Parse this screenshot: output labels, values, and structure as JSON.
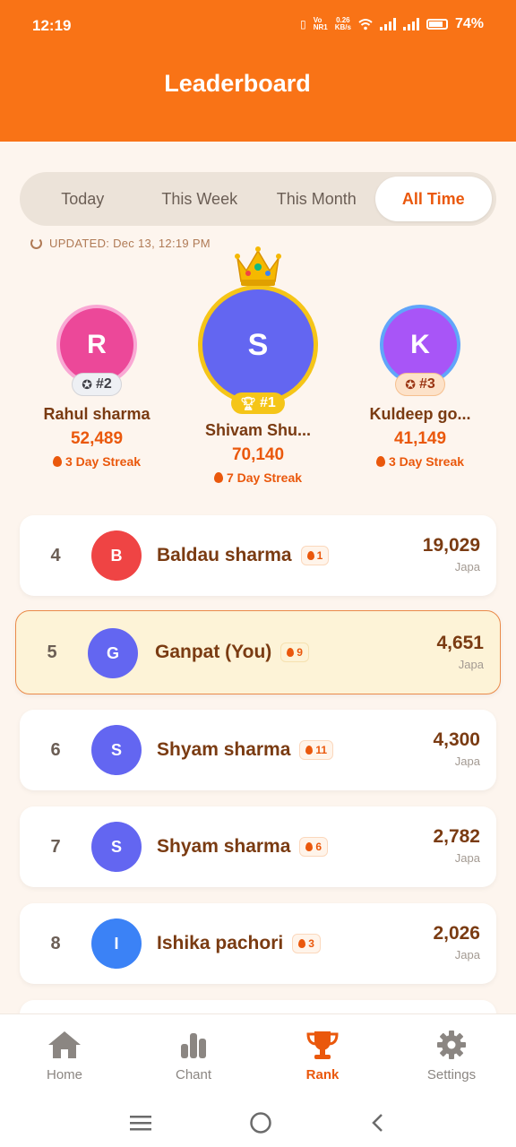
{
  "status": {
    "time": "12:19",
    "net": "Vo\nNR1",
    "speed": "0.26\nKB/s",
    "battery": "74%"
  },
  "header": {
    "title": "Leaderboard"
  },
  "tabs": [
    {
      "label": "Today",
      "active": false
    },
    {
      "label": "This Week",
      "active": false
    },
    {
      "label": "This Month",
      "active": false
    },
    {
      "label": "All Time",
      "active": true
    }
  ],
  "updated": "UPDATED: Dec 13, 12:19 PM",
  "podium": {
    "first": {
      "initial": "S",
      "rank": "#1",
      "name": "Shivam Shu...",
      "score": "70,140",
      "streak": "7 Day Streak",
      "color": "#6366f1",
      "ring": "#f5c518"
    },
    "second": {
      "initial": "R",
      "rank": "#2",
      "name": "Rahul sharma",
      "score": "52,489",
      "streak": "3 Day Streak",
      "color": "#ec4899",
      "ring": "#f9a8d4"
    },
    "third": {
      "initial": "K",
      "rank": "#3",
      "name": "Kuldeep go...",
      "score": "41,149",
      "streak": "3 Day Streak",
      "color": "#a855f7",
      "ring": "#60a5fa"
    }
  },
  "list": [
    {
      "rank": "4",
      "initial": "B",
      "name": "Baldau sharma",
      "streak": "1",
      "score": "19,029",
      "unit": "Japa",
      "color": "#ef4444"
    },
    {
      "rank": "5",
      "initial": "G",
      "name": "Ganpat (You)",
      "streak": "9",
      "score": "4,651",
      "unit": "Japa",
      "color": "#6366f1"
    },
    {
      "rank": "6",
      "initial": "S",
      "name": "Shyam sharma",
      "streak": "11",
      "score": "4,300",
      "unit": "Japa",
      "color": "#6366f1"
    },
    {
      "rank": "7",
      "initial": "S",
      "name": "Shyam sharma",
      "streak": "6",
      "score": "2,782",
      "unit": "Japa",
      "color": "#6366f1"
    },
    {
      "rank": "8",
      "initial": "I",
      "name": "Ishika pachori",
      "streak": "3",
      "score": "2,026",
      "unit": "Japa",
      "color": "#3b82f6"
    }
  ],
  "nav": [
    {
      "label": "Home",
      "icon": "home-icon"
    },
    {
      "label": "Chant",
      "icon": "bar-chart-icon"
    },
    {
      "label": "Rank",
      "icon": "trophy-icon"
    },
    {
      "label": "Settings",
      "icon": "gear-icon"
    }
  ]
}
